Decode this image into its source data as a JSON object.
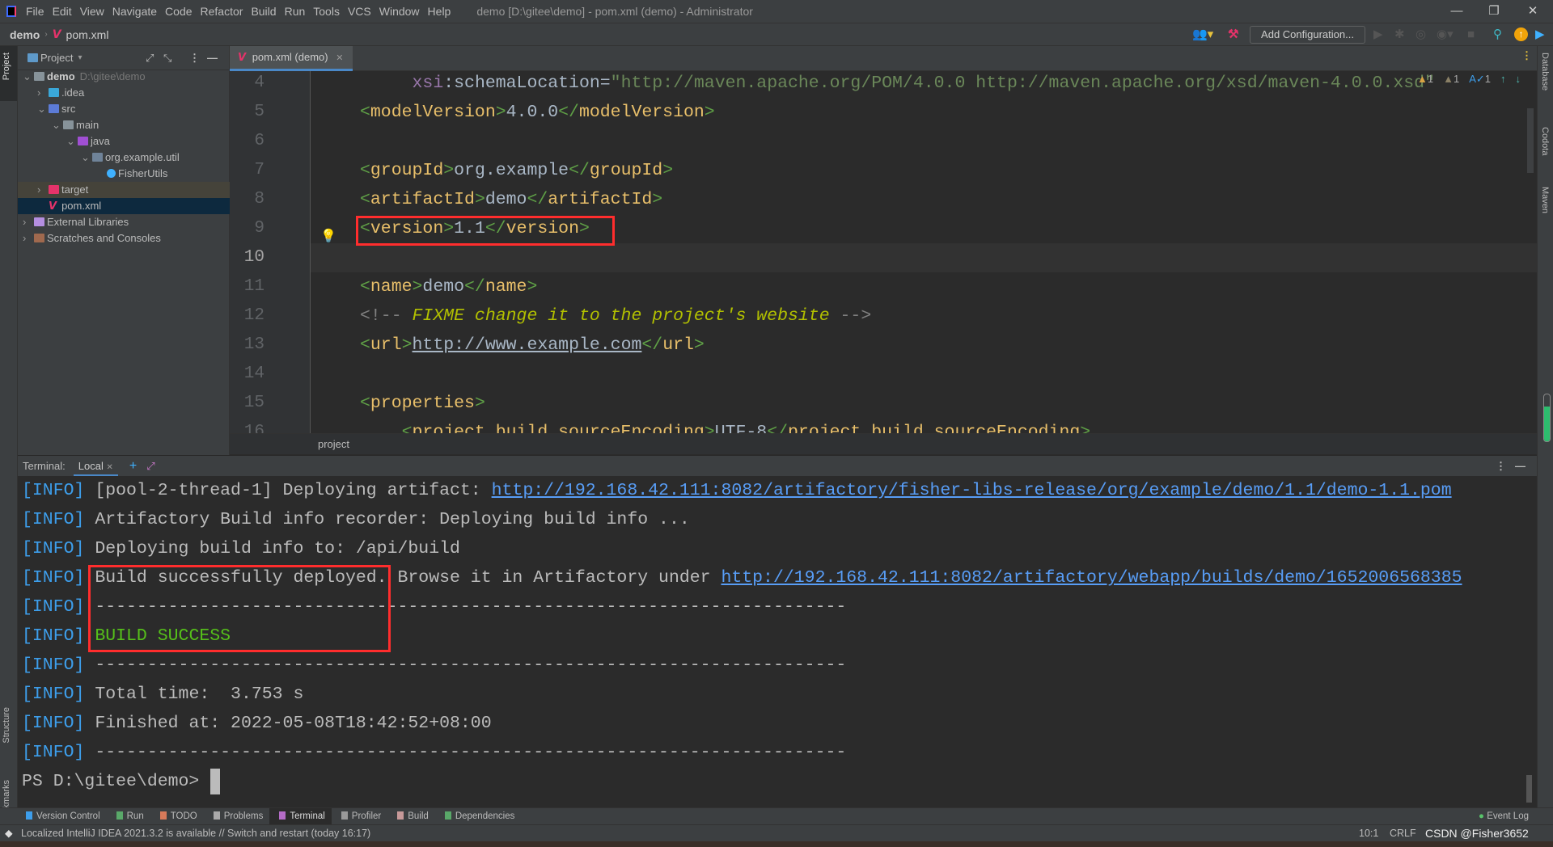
{
  "window": {
    "title": "demo [D:\\gitee\\demo] - pom.xml (demo) - Administrator",
    "minimize": "—",
    "restore": "❐",
    "close": "✕"
  },
  "menu": [
    "File",
    "Edit",
    "View",
    "Navigate",
    "Code",
    "Refactor",
    "Build",
    "Run",
    "Tools",
    "VCS",
    "Window",
    "Help"
  ],
  "navbar": {
    "project": "demo",
    "file": "pom.xml",
    "add_configuration": "Add Configuration..."
  },
  "left_strip": {
    "project": "Project",
    "structure": "Structure",
    "bookmarks": "Bookmarks"
  },
  "right_strip": {
    "database": "Database",
    "codota": "Codota",
    "maven": "Maven"
  },
  "project_panel": {
    "title": "Project",
    "tree": [
      {
        "label": "demo",
        "extra": "D:\\gitee\\demo",
        "depth": 0,
        "chev": "v",
        "icon": "folder",
        "color": "#87939a",
        "bold": true
      },
      {
        "label": ".idea",
        "depth": 1,
        "chev": ">",
        "icon": "folder",
        "color": "#3aa7d8"
      },
      {
        "label": "src",
        "depth": 1,
        "chev": "v",
        "icon": "folder",
        "color": "#5c7bd6"
      },
      {
        "label": "main",
        "depth": 2,
        "chev": "v",
        "icon": "folder",
        "color": "#87939a"
      },
      {
        "label": "java",
        "depth": 3,
        "chev": "v",
        "icon": "folder",
        "color": "#a04fd3"
      },
      {
        "label": "org.example.util",
        "depth": 4,
        "chev": "v",
        "icon": "package",
        "color": "#6f8399"
      },
      {
        "label": "FisherUtils",
        "depth": 5,
        "chev": "",
        "icon": "class",
        "color": "#3fb1ff"
      },
      {
        "label": "target",
        "depth": 1,
        "chev": ">",
        "icon": "folder",
        "color": "#e5336a",
        "state": "excluded"
      },
      {
        "label": "pom.xml",
        "depth": 1,
        "chev": "",
        "icon": "maven",
        "color": "#e5336a",
        "state": "selected"
      },
      {
        "label": "External Libraries",
        "depth": 0,
        "chev": ">",
        "icon": "library",
        "color": "#b48ee0"
      },
      {
        "label": "Scratches and Consoles",
        "depth": 0,
        "chev": ">",
        "icon": "scratch",
        "color": "#a0694e"
      }
    ]
  },
  "editor": {
    "tab": "pom.xml (demo)",
    "current_line": 10,
    "inspections": {
      "warnings": "1",
      "weak_warnings": "1",
      "typos": "1"
    },
    "breadcrumb": "project",
    "lines": [
      {
        "n": "4",
        "seg": [
          [
            "txt",
            "     "
          ],
          [
            "attr",
            "xsi"
          ],
          [
            "txt",
            ":schemaLocation="
          ],
          [
            "val",
            "\"http://maven.apache.org/POM/4.0.0 http://maven.apache.org/xsd/maven-4.0.0.xsd\""
          ]
        ]
      },
      {
        "n": "5",
        "seg": [
          [
            "br",
            "<"
          ],
          [
            "tag",
            "modelVersion"
          ],
          [
            "br",
            ">"
          ],
          [
            "txt",
            "4.0.0"
          ],
          [
            "br",
            "</"
          ],
          [
            "tag",
            "modelVersion"
          ],
          [
            "br",
            ">"
          ]
        ]
      },
      {
        "n": "6",
        "seg": []
      },
      {
        "n": "7",
        "seg": [
          [
            "br",
            "<"
          ],
          [
            "tag",
            "groupId"
          ],
          [
            "br",
            ">"
          ],
          [
            "txt",
            "org.example"
          ],
          [
            "br",
            "</"
          ],
          [
            "tag",
            "groupId"
          ],
          [
            "br",
            ">"
          ]
        ]
      },
      {
        "n": "8",
        "seg": [
          [
            "br",
            "<"
          ],
          [
            "tag",
            "artifactId"
          ],
          [
            "br",
            ">"
          ],
          [
            "txt",
            "demo"
          ],
          [
            "br",
            "</"
          ],
          [
            "tag",
            "artifactId"
          ],
          [
            "br",
            ">"
          ]
        ]
      },
      {
        "n": "9",
        "seg": [
          [
            "br",
            "<"
          ],
          [
            "tag",
            "version"
          ],
          [
            "br",
            ">"
          ],
          [
            "txt",
            "1.1"
          ],
          [
            "br",
            "</"
          ],
          [
            "tag",
            "version"
          ],
          [
            "br",
            ">"
          ]
        ]
      },
      {
        "n": "10",
        "seg": []
      },
      {
        "n": "11",
        "seg": [
          [
            "br",
            "<"
          ],
          [
            "tag",
            "name"
          ],
          [
            "br",
            ">"
          ],
          [
            "txt",
            "demo"
          ],
          [
            "br",
            "</"
          ],
          [
            "tag",
            "name"
          ],
          [
            "br",
            ">"
          ]
        ]
      },
      {
        "n": "12",
        "seg": [
          [
            "com",
            "<!-- "
          ],
          [
            "comi",
            "FIXME change it to the project's website"
          ],
          [
            "com",
            " -->"
          ]
        ]
      },
      {
        "n": "13",
        "seg": [
          [
            "br",
            "<"
          ],
          [
            "tag",
            "url"
          ],
          [
            "br",
            ">"
          ],
          [
            "link",
            "http://www.example.com"
          ],
          [
            "br",
            "</"
          ],
          [
            "tag",
            "url"
          ],
          [
            "br",
            ">"
          ]
        ]
      },
      {
        "n": "14",
        "seg": []
      },
      {
        "n": "15",
        "seg": [
          [
            "br",
            "<"
          ],
          [
            "tag",
            "properties"
          ],
          [
            "br",
            ">"
          ]
        ]
      },
      {
        "n": "16",
        "seg": [
          [
            "txt",
            "    "
          ],
          [
            "br",
            "<"
          ],
          [
            "tag",
            "project.build.sourceEncoding"
          ],
          [
            "br",
            ">"
          ],
          [
            "txt",
            "UTF-8"
          ],
          [
            "br",
            "</"
          ],
          [
            "tag",
            "project.build.sourceEncoding"
          ],
          [
            "br",
            ">"
          ]
        ]
      }
    ]
  },
  "terminal": {
    "label": "Terminal:",
    "tab": "Local",
    "lines": [
      [
        [
          "info",
          "[INFO]"
        ],
        [
          "txt",
          " [pool-2-thread-1] Deploying artifact: "
        ],
        [
          "url",
          "http://192.168.42.111:8082/artifactory/fisher-libs-release/org/example/demo/1.1/demo-1.1.pom"
        ]
      ],
      [
        [
          "info",
          "[INFO]"
        ],
        [
          "txt",
          " Artifactory Build info recorder: Deploying build info ..."
        ]
      ],
      [
        [
          "info",
          "[INFO]"
        ],
        [
          "txt",
          " Deploying build info to: /api/build"
        ]
      ],
      [
        [
          "info",
          "[INFO]"
        ],
        [
          "txt",
          " Build successfully deployed. Browse it in Artifactory under "
        ],
        [
          "url",
          "http://192.168.42.111:8082/artifactory/webapp/builds/demo/1652006568385"
        ]
      ],
      [
        [
          "info",
          "[INFO]"
        ],
        [
          "txt",
          " ------------------------------------------------------------------------"
        ]
      ],
      [
        [
          "info",
          "[INFO]"
        ],
        [
          "txt",
          " "
        ],
        [
          "ok",
          "BUILD SUCCESS"
        ]
      ],
      [
        [
          "info",
          "[INFO]"
        ],
        [
          "txt",
          " ------------------------------------------------------------------------"
        ]
      ],
      [
        [
          "info",
          "[INFO]"
        ],
        [
          "txt",
          " Total time:  3.753 s"
        ]
      ],
      [
        [
          "info",
          "[INFO]"
        ],
        [
          "txt",
          " Finished at: 2022-05-08T18:42:52+08:00"
        ]
      ],
      [
        [
          "info",
          "[INFO]"
        ],
        [
          "txt",
          " ------------------------------------------------------------------------"
        ]
      ],
      [
        [
          "txt",
          "PS D:\\gitee\\demo> "
        ]
      ]
    ]
  },
  "tool_windows": [
    {
      "label": "Version Control",
      "icon": "branch",
      "color": "#3d9eeb"
    },
    {
      "label": "Run",
      "icon": "play",
      "color": "#59a869"
    },
    {
      "label": "TODO",
      "icon": "list",
      "color": "#d87a5a"
    },
    {
      "label": "Problems",
      "icon": "warning",
      "color": "#aaaaaa"
    },
    {
      "label": "Terminal",
      "icon": "terminal",
      "color": "#b56cc7",
      "active": true
    },
    {
      "label": "Profiler",
      "icon": "gauge",
      "color": "#999999"
    },
    {
      "label": "Build",
      "icon": "hammer",
      "color": "#c79999"
    },
    {
      "label": "Dependencies",
      "icon": "grid",
      "color": "#59a869"
    }
  ],
  "event_log": "Event Log",
  "status": {
    "message": "Localized IntelliJ IDEA 2021.3.2 is available // Switch and restart (today 16:17)",
    "position": "10:1",
    "line_separator": "CRLF",
    "watermark": "CSDN @Fisher3652"
  },
  "memory_usage_percent": 75
}
